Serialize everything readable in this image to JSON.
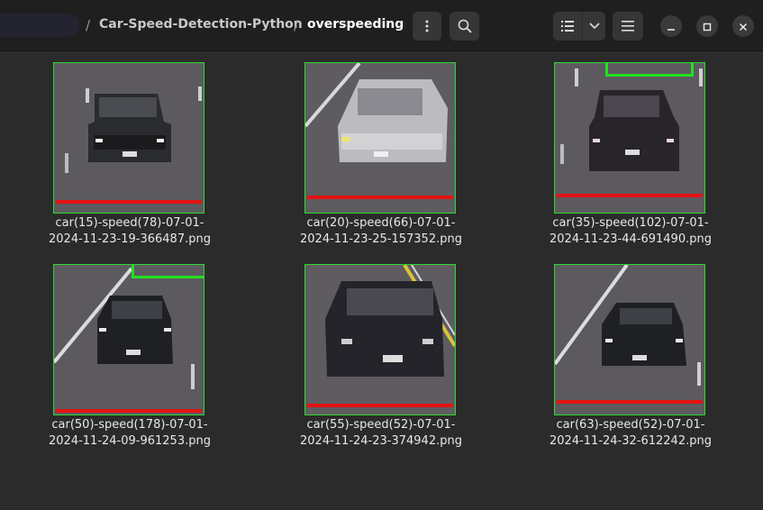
{
  "header": {
    "breadcrumbs": [
      "Car-Speed-Detection-Python",
      "overspeeding"
    ],
    "separator": "/"
  },
  "icons": {
    "menu": "vertical-dots-icon",
    "search": "search-icon",
    "view": "list-view-icon",
    "dropdown": "chevron-down-icon",
    "hamburger": "hamburger-menu-icon",
    "minimize": "minimize-icon",
    "maximize": "maximize-icon",
    "close": "close-icon"
  },
  "files": [
    {
      "line1": "car(15)-speed(78)-07-01-",
      "line2": "2024-11-23-19-366487.png"
    },
    {
      "line1": "car(20)-speed(66)-07-01-",
      "line2": "2024-11-23-25-157352.png"
    },
    {
      "line1": "car(35)-speed(102)-07-01-",
      "line2": "2024-11-23-44-691490.png"
    },
    {
      "line1": "car(50)-speed(178)-07-01-",
      "line2": "2024-11-24-09-961253.png"
    },
    {
      "line1": "car(55)-speed(52)-07-01-",
      "line2": "2024-11-24-23-374942.png"
    },
    {
      "line1": "car(63)-speed(52)-07-01-",
      "line2": "2024-11-24-32-612242.png"
    }
  ],
  "colors": {
    "detection_box": "#2fd82f",
    "speed_line": "#e31212"
  }
}
